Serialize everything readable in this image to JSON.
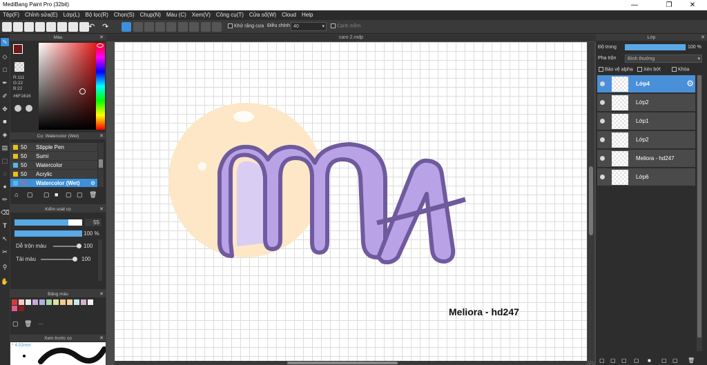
{
  "window": {
    "title": "MediBang Paint Pro (32bit)",
    "minimize": "—",
    "maximize": "❐",
    "close": "✕"
  },
  "menu": [
    "Tệp(F)",
    "Chỉnh sửa(E)",
    "Lớp(L)",
    "Bộ lọc(R)",
    "Chọn(S)",
    "Chụp(N)",
    "Màu (C)",
    "Xem(V)",
    "Công cụ(T)",
    "Cửa sổ(W)",
    "Cloud",
    "Help"
  ],
  "toolbar": {
    "antialias_label": "Khử răng cưa",
    "correction_label": "Điều chỉnh",
    "correction_value": "40",
    "edge_label": "Cạnh mềm"
  },
  "color_panel": {
    "title": "Màu",
    "rgb": {
      "r": "R:111",
      "g": "G:22",
      "b": "B:22"
    },
    "hex": "#6F1616",
    "primary_color": "#6f1616"
  },
  "brush_panel": {
    "title": "Cọ: Watercolor (Wet)",
    "items": [
      {
        "size": "50",
        "name": "Stipple Pen",
        "swatch": "#e8c21a"
      },
      {
        "size": "50",
        "name": "Sumi",
        "swatch": "#e8c21a"
      },
      {
        "size": "50",
        "name": "Watercolor",
        "swatch": "#5ab7e6"
      },
      {
        "size": "50",
        "name": "Acrylic",
        "swatch": "#e8c21a"
      },
      {
        "size": "55",
        "name": "Watercolor (Wet)",
        "swatch": "#5ab7e6"
      }
    ]
  },
  "brush_control": {
    "title": "Kiểm soát cọ",
    "size_value": "55",
    "opacity_value": "100 %",
    "blend_label": "Dễ trộn màu",
    "blend_value": "100",
    "reload_label": "Tải màu",
    "reload_value": "100",
    "size_fraction": 0.8,
    "opacity_fraction": 1.0
  },
  "palette_panel": {
    "title": "Bảng màu",
    "swatches": [
      "#d83a3a",
      "#f5c8c8",
      "#e8e8e8",
      "#c8a8d8",
      "#b0b0e0",
      "#a8d8a8",
      "#e0e0a0",
      "#f0c890",
      "#f5d0a0",
      "#c8e8e8",
      "#d8b0c8",
      "#f0f0f0",
      "#e05a8a",
      "#8c1c1c"
    ],
    "more_label": "···"
  },
  "preview_panel": {
    "title": "Xem trước cọ",
    "size_label": "4.02mm"
  },
  "document": {
    "tab_title": "caro 2.mdp",
    "canvas_text": "Meliora - hd247"
  },
  "layers_panel": {
    "title": "Lớp",
    "opacity_label": "Độ trong",
    "opacity_value": "100 %",
    "opacity_fraction": 1.0,
    "blend_label": "Pha trộn",
    "blend_value": "Bình thường",
    "protect_alpha_label": "Bảo vệ alpha",
    "clip_label": "Xén bớt",
    "lock_label": "Khóa",
    "layers": [
      {
        "name": "Lớp4",
        "selected": true
      },
      {
        "name": "Lớp2",
        "selected": false
      },
      {
        "name": "Lớp1",
        "selected": false
      },
      {
        "name": "Lớp2",
        "selected": false
      },
      {
        "name": "Meliora - hd247",
        "selected": false
      },
      {
        "name": "Lớp6",
        "selected": false
      }
    ]
  },
  "colors": {
    "accent": "#4a90d9",
    "letter_fill": "#b9a3e6",
    "letter_outline": "#6f5a9e",
    "bubble": "#fde7c7"
  }
}
